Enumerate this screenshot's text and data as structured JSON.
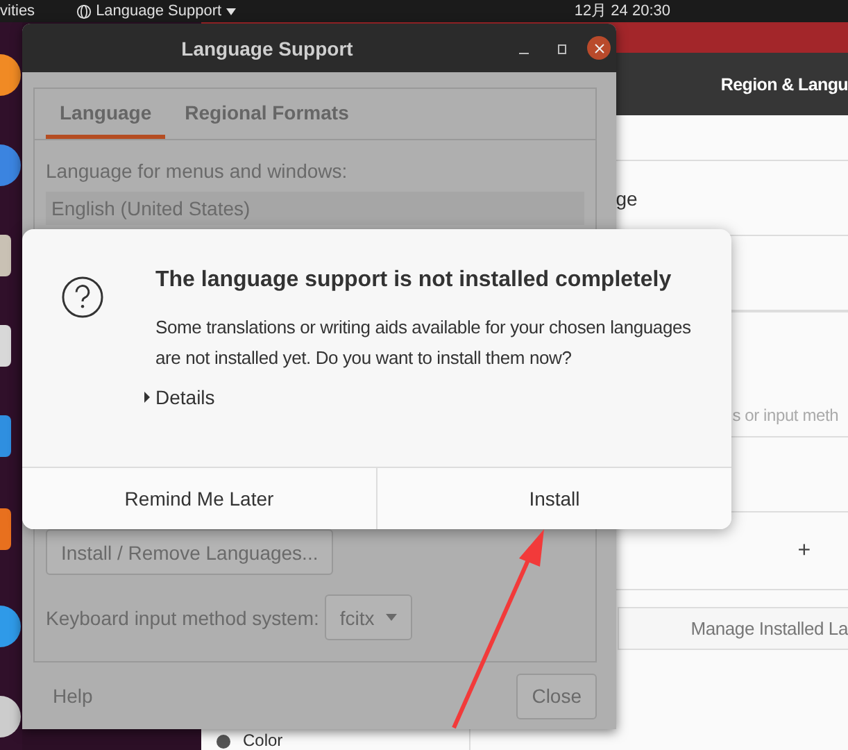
{
  "top_bar": {
    "activities": "vities",
    "app_menu": "Language Support",
    "clock": "12月 24  20:30"
  },
  "settings_window": {
    "title": "Region & Langu",
    "language_row": "ge",
    "input_sources_hint": "s or input meth",
    "add_button": "+",
    "manage_button": "Manage Installed La",
    "sidebar_items": [
      {
        "label": "Color"
      }
    ]
  },
  "language_window": {
    "title": "Language Support",
    "tabs": [
      {
        "label": "Language",
        "selected": true
      },
      {
        "label": "Regional Formats",
        "selected": false
      }
    ],
    "language_label": "Language for menus and windows:",
    "languages": [
      {
        "label": "English (United States)"
      }
    ],
    "install_button": "Install / Remove Languages...",
    "input_method_label": "Keyboard input method system:",
    "input_method": "fcitx",
    "help_button": "Help",
    "close_button": "Close"
  },
  "dialog": {
    "title": "The language support is not installed completely",
    "message": "Some translations or writing aids available for your chosen languages are not installed yet. Do you want to install them now?",
    "details": {
      "label": "Details",
      "expanded": false
    },
    "buttons": [
      {
        "label": "Remind Me Later"
      },
      {
        "label": "Install"
      }
    ]
  }
}
